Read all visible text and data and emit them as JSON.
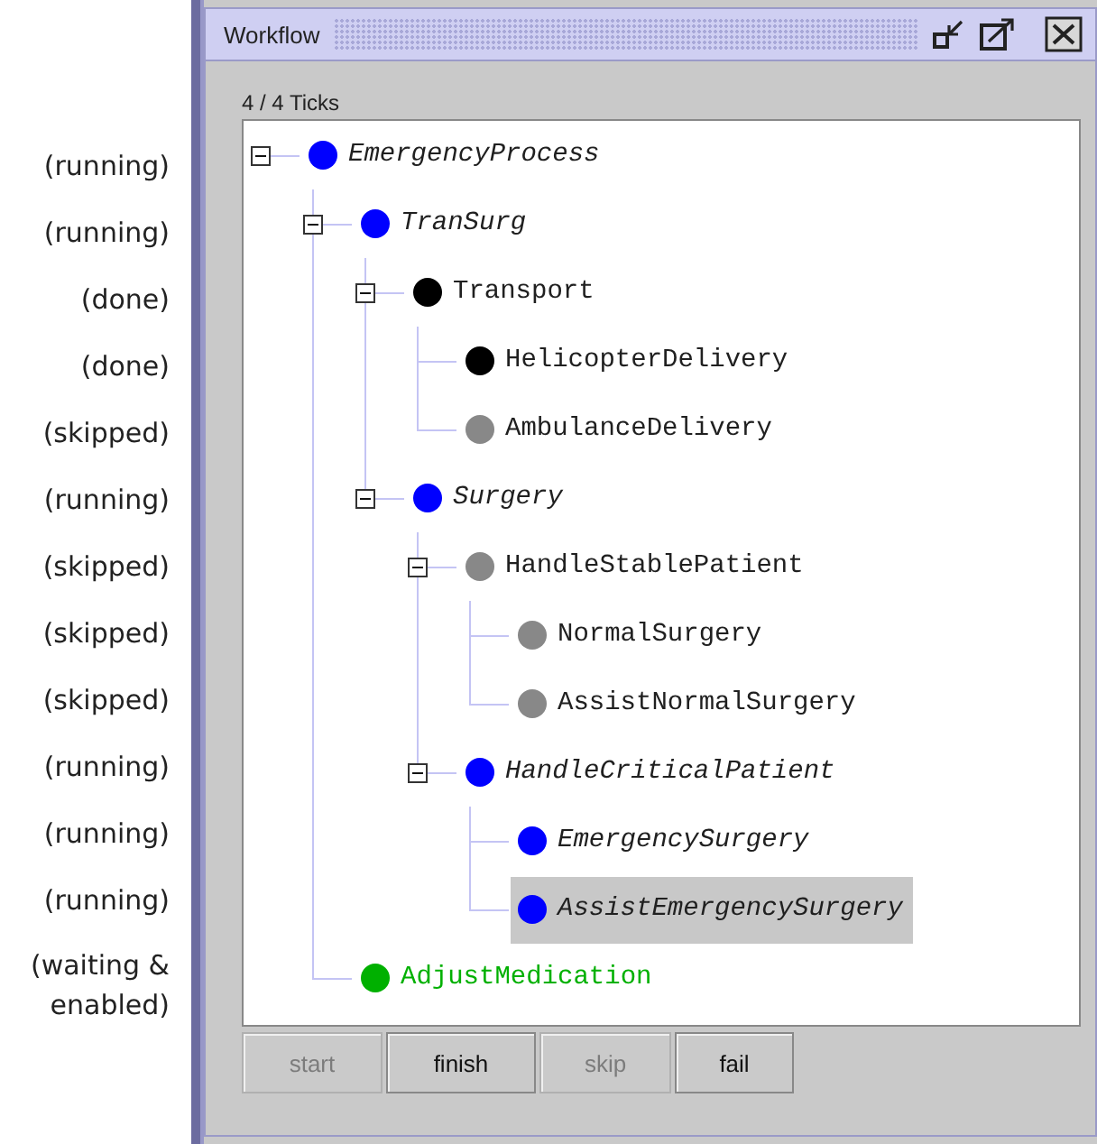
{
  "annotations": [
    "(running)",
    "(running)",
    "(done)",
    "(done)",
    "(skipped)",
    "(running)",
    "(skipped)",
    "(skipped)",
    "(skipped)",
    "(running)",
    "(running)",
    "(running)",
    "(waiting &\nenabled)"
  ],
  "window": {
    "title": "Workflow",
    "ticks": "4 / 4 Ticks"
  },
  "tree": [
    {
      "name": "EmergencyProcess",
      "color": "#0000ff",
      "italic": true,
      "enabled": false,
      "expanded": true,
      "selected": false,
      "children": [
        {
          "name": "TranSurg",
          "color": "#0000ff",
          "italic": true,
          "enabled": false,
          "expanded": true,
          "selected": false,
          "children": [
            {
              "name": "Transport",
              "color": "#000000",
              "italic": false,
              "enabled": false,
              "expanded": true,
              "selected": false,
              "children": [
                {
                  "name": "HelicopterDelivery",
                  "color": "#000000",
                  "italic": false,
                  "enabled": false,
                  "selected": false
                },
                {
                  "name": "AmbulanceDelivery",
                  "color": "#888888",
                  "italic": false,
                  "enabled": false,
                  "selected": false
                }
              ]
            },
            {
              "name": "Surgery",
              "color": "#0000ff",
              "italic": true,
              "enabled": false,
              "expanded": true,
              "selected": false,
              "children": [
                {
                  "name": "HandleStablePatient",
                  "color": "#888888",
                  "italic": false,
                  "enabled": false,
                  "expanded": true,
                  "selected": false,
                  "children": [
                    {
                      "name": "NormalSurgery",
                      "color": "#888888",
                      "italic": false,
                      "enabled": false,
                      "selected": false
                    },
                    {
                      "name": "AssistNormalSurgery",
                      "color": "#888888",
                      "italic": false,
                      "enabled": false,
                      "selected": false
                    }
                  ]
                },
                {
                  "name": "HandleCriticalPatient",
                  "color": "#0000ff",
                  "italic": true,
                  "enabled": false,
                  "expanded": true,
                  "selected": false,
                  "children": [
                    {
                      "name": "EmergencySurgery",
                      "color": "#0000ff",
                      "italic": true,
                      "enabled": false,
                      "selected": false
                    },
                    {
                      "name": "AssistEmergencySurgery",
                      "color": "#0000ff",
                      "italic": true,
                      "enabled": false,
                      "selected": true
                    }
                  ]
                }
              ]
            }
          ]
        },
        {
          "name": "AdjustMedication",
          "color": "#00b000",
          "italic": false,
          "enabled": true,
          "selected": false
        }
      ]
    }
  ],
  "buttons": [
    {
      "label": "start",
      "disabled": true
    },
    {
      "label": "finish",
      "disabled": false
    },
    {
      "label": "skip",
      "disabled": true
    },
    {
      "label": "fail",
      "disabled": false
    }
  ]
}
